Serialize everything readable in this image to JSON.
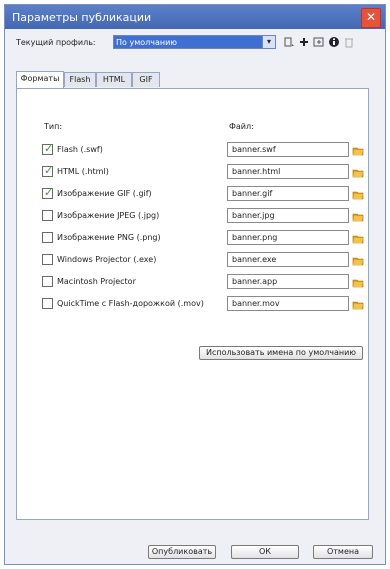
{
  "window": {
    "title": "Параметры публикации",
    "close_glyph": "✕"
  },
  "profile": {
    "label": "Текущий профиль:",
    "value": "По умолчанию",
    "arrow": "▾"
  },
  "toolbar": {
    "icons": [
      "profile-options-icon",
      "add-profile-icon",
      "import-export-icon",
      "info-icon",
      "delete-icon"
    ]
  },
  "tabs": [
    "Форматы",
    "Flash",
    "HTML",
    "GIF"
  ],
  "columns": {
    "type": "Тип:",
    "file": "Файл:"
  },
  "formats": [
    {
      "label": "Flash (.swf)",
      "checked": true,
      "file": "banner.swf"
    },
    {
      "label": "HTML (.html)",
      "checked": true,
      "file": "banner.html"
    },
    {
      "label": "Изображение GIF (.gif)",
      "checked": true,
      "file": "banner.gif"
    },
    {
      "label": "Изображение JPEG (.jpg)",
      "checked": false,
      "file": "banner.jpg"
    },
    {
      "label": "Изображение PNG (.png)",
      "checked": false,
      "file": "banner.png"
    },
    {
      "label": "Windows Projector (.exe)",
      "checked": false,
      "file": "banner.exe"
    },
    {
      "label": "Macintosh Projector",
      "checked": false,
      "file": "banner.app"
    },
    {
      "label": "QuickTime с Flash-дорожкой (.mov)",
      "checked": false,
      "file": "banner.mov"
    }
  ],
  "defaults_button": "Использовать имена по умолчанию",
  "buttons": {
    "publish": "Опубликовать",
    "ok": "ОК",
    "cancel": "Отмена"
  },
  "colors": {
    "accent": "#4567b3",
    "check": "#3a9a2a",
    "folder": "#e0a21a"
  }
}
